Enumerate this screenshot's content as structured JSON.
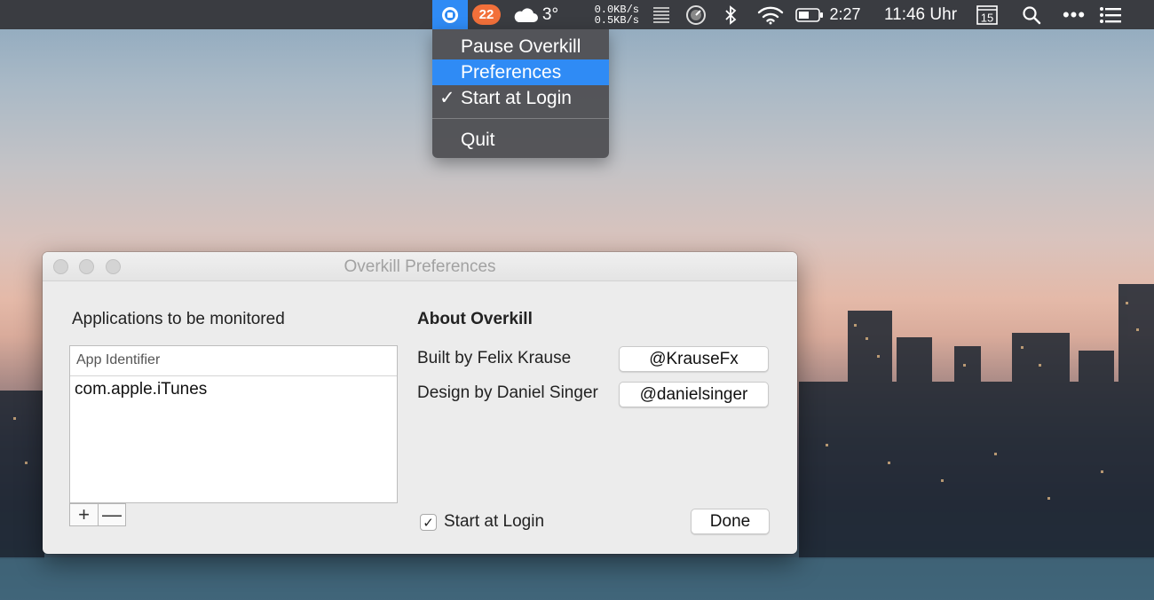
{
  "menubar": {
    "badge_count": "22",
    "temperature": "3°",
    "net_down": "0.0KB/s",
    "net_up": "0.5KB/s",
    "battery_time": "2:27",
    "clock": "11:46 Uhr",
    "calendar_day": "15",
    "more_dots": "•••",
    "accent_color": "#2f8bf5",
    "badge_color": "#f2703a"
  },
  "dropdown": {
    "items": [
      {
        "label": "Pause Overkill",
        "checked": false,
        "highlighted": false
      },
      {
        "label": "Preferences",
        "checked": false,
        "highlighted": true
      },
      {
        "label": "Start at Login",
        "checked": true,
        "highlighted": false
      }
    ],
    "quit_label": "Quit",
    "check_glyph": "✓"
  },
  "window": {
    "title": "Overkill Preferences",
    "apps_label": "Applications to be monitored",
    "table": {
      "header": "App Identifier",
      "rows": [
        "com.apple.iTunes"
      ]
    },
    "add_glyph": "+",
    "remove_glyph": "—",
    "about": {
      "title": "About Overkill",
      "built_by_label": "Built by Felix Krause",
      "built_by_handle": "@KrauseFx",
      "design_by_label": "Design by Daniel Singer",
      "design_by_handle": "@danielsinger"
    },
    "start_login_label": "Start at Login",
    "start_login_checked": true,
    "check_glyph": "✓",
    "done_label": "Done"
  }
}
